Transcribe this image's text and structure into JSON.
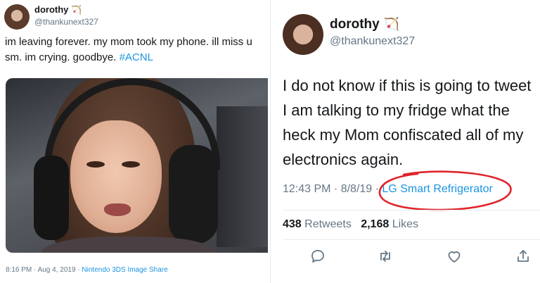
{
  "left_tweet": {
    "display_name": "dorothy",
    "name_badge": "🏹",
    "handle": "@thankunext327",
    "text_main": "im leaving forever. my mom took my phone. ill miss u sm. im crying. goodbye. ",
    "hashtag": "#ACNL",
    "time": "8:16 PM · Aug 4, 2019 · ",
    "source": "Nintendo 3DS Image Share"
  },
  "right_tweet": {
    "display_name": "dorothy",
    "name_badge": "🏹",
    "handle": "@thankunext327",
    "text": "I do not know if this is going to tweet I am talking to my fridge what the heck my Mom confiscated all of my electronics again.",
    "time": "12:43 PM · 8/8/19 · ",
    "source": "LG Smart Refrigerator",
    "retweets_count": "438",
    "retweets_label": "Retweets",
    "likes_count": "2,168",
    "likes_label": "Likes"
  },
  "icons": {
    "reply": "reply-icon",
    "retweet": "retweet-icon",
    "like": "heart-icon",
    "share": "share-icon"
  },
  "colors": {
    "link": "#1b95e0",
    "secondary_text": "#657786",
    "annotation_circle": "#e0242b"
  }
}
